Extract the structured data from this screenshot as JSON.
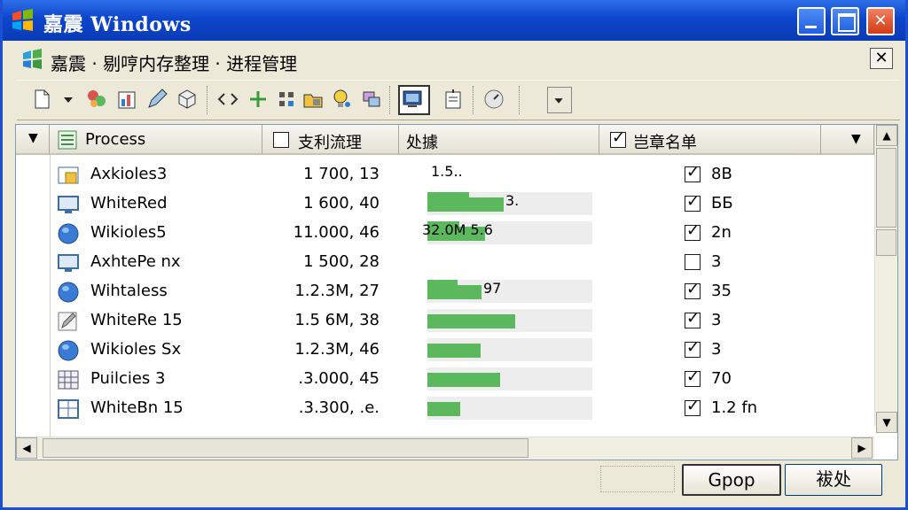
{
  "window": {
    "title": "嘉震 Windows",
    "title_buttons": [
      "minimize",
      "maximize",
      "close"
    ]
  },
  "subheader": {
    "title": "嘉震 · 剔哼内存整理 · 进程管理",
    "close_label": "✕"
  },
  "toolbar": {
    "icons": [
      "new-doc-icon",
      "dropdown-arrow-icon",
      "components-icon",
      "chart-icon",
      "edit-icon",
      "cube-icon",
      "code-icon",
      "plus-icon",
      "grid-icon",
      "folder-lock-icon",
      "bulb-icon",
      "layers-icon",
      "monitor-icon",
      "note-icon",
      "gauge-icon",
      "more-dropdown-icon"
    ]
  },
  "columns": {
    "process": "Process",
    "memory": "支利流理",
    "usage": "处據",
    "list": "岂章名单"
  },
  "rows": [
    {
      "name": "Axkioles3",
      "memory": "1 700, 13",
      "bar": 0,
      "bar_label": "1.5..",
      "checked": true,
      "count": "8B",
      "icon": "folder-icon"
    },
    {
      "name": "WhiteRed",
      "memory": "1 600, 40",
      "bar": 0.46,
      "bar_label": "3.",
      "checked": true,
      "count": "ББ",
      "icon": "monitor-icon"
    },
    {
      "name": "Wikioles5",
      "memory": "11.000, 46",
      "bar": 0.35,
      "bar_label": "32.0M  5.6",
      "checked": true,
      "count": "2n",
      "icon": "globe-icon"
    },
    {
      "name": "AxhtePe nx",
      "memory": "1 500, 28",
      "bar": 0,
      "bar_label": "",
      "checked": false,
      "count": "3",
      "icon": "monitor-icon"
    },
    {
      "name": "Wihtaless",
      "memory": "1.2.3M, 27",
      "bar": 0.33,
      "bar_label": "97",
      "checked": true,
      "count": "35",
      "icon": "globe-icon"
    },
    {
      "name": "WhiteRe 15",
      "memory": "1.5 6M, 38",
      "bar": 0.53,
      "bar_label": "",
      "checked": true,
      "count": "3",
      "icon": "pen-icon"
    },
    {
      "name": "Wikioles Sx",
      "memory": "1.2.3M, 46",
      "bar": 0.32,
      "bar_label": "",
      "checked": true,
      "count": "3",
      "icon": "globe-icon"
    },
    {
      "name": "Puilcies 3",
      "memory": ".3.000, 45",
      "bar": 0.44,
      "bar_label": "",
      "checked": true,
      "count": "70",
      "icon": "grid-icon"
    },
    {
      "name": "WhiteBn 15",
      "memory": ".3.300, .e.",
      "bar": 0.2,
      "bar_label": "",
      "checked": true,
      "count": "1.2  fn",
      "icon": "table-icon"
    }
  ],
  "buttons": {
    "ok": "Gpop",
    "cancel": "袚处"
  }
}
